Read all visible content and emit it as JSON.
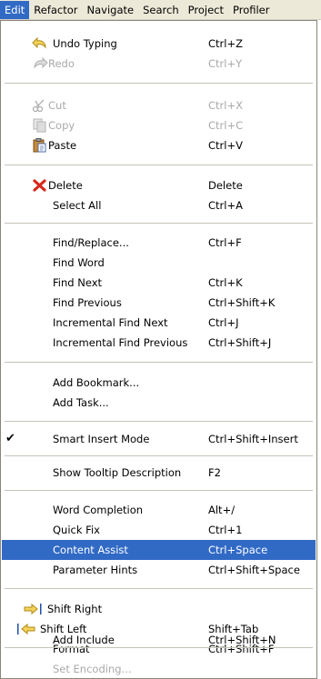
{
  "menubar": {
    "items": [
      "Edit",
      "Refactor",
      "Navigate",
      "Search",
      "Project",
      "Profiler"
    ]
  },
  "menu": {
    "items": [
      {
        "label": "Undo Typing",
        "shortcut": "Ctrl+Z",
        "icon": "undo-icon",
        "disabled": false
      },
      {
        "label": "Redo",
        "shortcut": "Ctrl+Y",
        "icon": "redo-icon",
        "disabled": true
      },
      {
        "label": "Cut",
        "shortcut": "Ctrl+X",
        "icon": "scissors-icon",
        "disabled": true
      },
      {
        "label": "Copy",
        "shortcut": "Ctrl+C",
        "icon": "copy-icon",
        "disabled": true
      },
      {
        "label": "Paste",
        "shortcut": "Ctrl+V",
        "icon": "paste-icon",
        "disabled": false
      },
      {
        "label": "Delete",
        "shortcut": "Delete",
        "icon": "delete-x-icon",
        "disabled": false
      },
      {
        "label": "Select All",
        "shortcut": "Ctrl+A",
        "disabled": false
      },
      {
        "label": "Find/Replace...",
        "shortcut": "Ctrl+F",
        "disabled": false
      },
      {
        "label": "Find Word",
        "shortcut": "",
        "disabled": false
      },
      {
        "label": "Find Next",
        "shortcut": "Ctrl+K",
        "disabled": false
      },
      {
        "label": "Find Previous",
        "shortcut": "Ctrl+Shift+K",
        "disabled": false
      },
      {
        "label": "Incremental Find Next",
        "shortcut": "Ctrl+J",
        "disabled": false
      },
      {
        "label": "Incremental Find Previous",
        "shortcut": "Ctrl+Shift+J",
        "disabled": false
      },
      {
        "label": "Add Bookmark...",
        "shortcut": "",
        "disabled": false
      },
      {
        "label": "Add Task...",
        "shortcut": "",
        "disabled": false
      },
      {
        "label": "Smart Insert Mode",
        "shortcut": "Ctrl+Shift+Insert",
        "checked": true,
        "disabled": false
      },
      {
        "label": "Show Tooltip Description",
        "shortcut": "F2",
        "disabled": false
      },
      {
        "label": "Word Completion",
        "shortcut": "Alt+/",
        "disabled": false
      },
      {
        "label": "Quick Fix",
        "shortcut": "Ctrl+1",
        "disabled": false
      },
      {
        "label": "Content Assist",
        "shortcut": "Ctrl+Space",
        "selected": true,
        "disabled": false
      },
      {
        "label": "Parameter Hints",
        "shortcut": "Ctrl+Shift+Space",
        "disabled": false
      },
      {
        "label": "Shift Right",
        "shortcut": "",
        "icon": "shift-right-icon",
        "disabled": false
      },
      {
        "label": "Shift Left",
        "shortcut": "Shift+Tab",
        "icon": "shift-left-icon",
        "disabled": false
      },
      {
        "label": "Format",
        "shortcut": "Ctrl+Shift+F",
        "disabled": false
      },
      {
        "label": "Add Include",
        "shortcut": "Ctrl+Shift+N",
        "disabled": false
      },
      {
        "label": "Set Encoding...",
        "shortcut": "",
        "disabled": true
      }
    ]
  },
  "colors": {
    "selection": "#316ac5",
    "menubar_bg": "#ece9d8",
    "disabled_text": "#a9a9a9"
  }
}
